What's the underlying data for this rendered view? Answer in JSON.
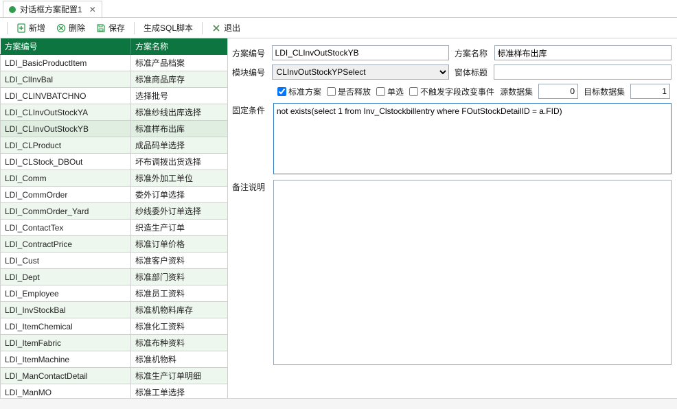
{
  "tab": {
    "title": "对话框方案配置1"
  },
  "toolbar": {
    "btn_new": "新增",
    "btn_delete": "删除",
    "btn_save": "保存",
    "btn_gensql": "生成SQL脚本",
    "btn_exit": "退出"
  },
  "grid": {
    "cols": [
      "方案编号",
      "方案名称"
    ],
    "rows": [
      {
        "c0": "LDI_BasicProductItem",
        "c1": "标准产品档案"
      },
      {
        "c0": "LDI_ClInvBal",
        "c1": "标准商品库存"
      },
      {
        "c0": "LDI_CLINVBATCHNO",
        "c1": "选择批号"
      },
      {
        "c0": "LDI_CLInvOutStockYA",
        "c1": "标准纱线出库选择"
      },
      {
        "c0": "LDI_CLInvOutStockYB",
        "c1": "标准样布出库",
        "selected": true
      },
      {
        "c0": "LDI_CLProduct",
        "c1": "成品码单选择"
      },
      {
        "c0": "LDI_CLStock_DBOut",
        "c1": "坏布调拨出货选择"
      },
      {
        "c0": "LDI_Comm",
        "c1": "标准外加工单位"
      },
      {
        "c0": "LDI_CommOrder",
        "c1": "委外订单选择"
      },
      {
        "c0": "LDI_CommOrder_Yard",
        "c1": "纱线委外订单选择"
      },
      {
        "c0": "LDI_ContactTex",
        "c1": "织造生产订单"
      },
      {
        "c0": "LDI_ContractPrice",
        "c1": "标准订单价格"
      },
      {
        "c0": "LDI_Cust",
        "c1": "标准客户资料"
      },
      {
        "c0": "LDI_Dept",
        "c1": "标准部门资料"
      },
      {
        "c0": "LDI_Employee",
        "c1": "标准员工资料"
      },
      {
        "c0": "LDI_InvStockBal",
        "c1": "标准机物料库存"
      },
      {
        "c0": "LDI_ItemChemical",
        "c1": "标准化工资料"
      },
      {
        "c0": "LDI_ItemFabric",
        "c1": "标准布种资料"
      },
      {
        "c0": "LDI_ItemMachine",
        "c1": "标准机物料"
      },
      {
        "c0": "LDI_ManContactDetail",
        "c1": "标准生产订单明细"
      },
      {
        "c0": "LDI_ManMO",
        "c1": "标准工单选择"
      }
    ]
  },
  "form": {
    "lbl_code": "方案编号",
    "val_code": "LDI_CLInvOutStockYB",
    "lbl_name": "方案名称",
    "val_name": "标准样布出库",
    "lbl_module": "模块编号",
    "val_module": "CLInvOutStockYPSelect",
    "lbl_wintitle": "窗体标题",
    "val_wintitle": "",
    "chk_standard": "标准方案",
    "chk_release": "是否释放",
    "chk_single": "单选",
    "chk_noevent": "不触发字段改变事件",
    "lbl_srcds": "源数据集",
    "val_srcds": "0",
    "lbl_dstds": "目标数据集",
    "val_dstds": "1",
    "lbl_fixcond": "固定条件",
    "val_fixcond": "not exists(select 1 from Inv_Clstockbillentry where FOutStockDetailID = a.FID)",
    "lbl_remark": "备注说明",
    "val_remark": ""
  },
  "checkboxes": {
    "standard": true,
    "release": false,
    "single": false,
    "noevent": false
  }
}
